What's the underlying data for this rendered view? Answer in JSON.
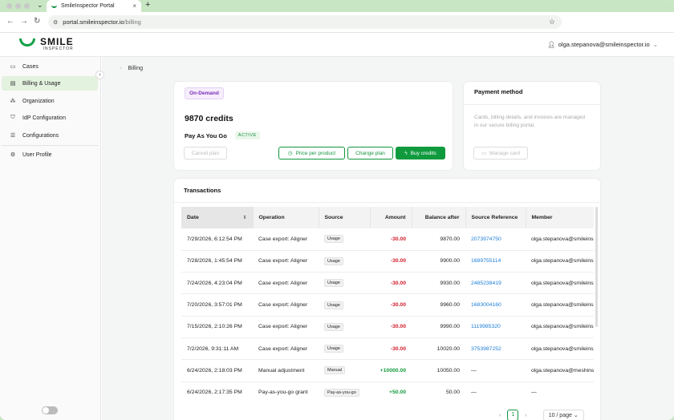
{
  "browser": {
    "tab_title": "SmileInspector Portal",
    "url_host": "portal.smileinspector.io",
    "url_path": "/billing"
  },
  "app": {
    "brand": "SMILE",
    "brand_sub": "INSPECTOR",
    "user_email": "olga.stepanova@smileinspector.io",
    "accent": "#0f9a3e"
  },
  "sidebar": {
    "items": [
      {
        "label": "Cases",
        "icon": "folder-icon"
      },
      {
        "label": "Billing & Usage",
        "icon": "billing-icon"
      },
      {
        "label": "Organization",
        "icon": "organization-icon"
      },
      {
        "label": "IdP Configuration",
        "icon": "shield-icon"
      },
      {
        "label": "Configurations",
        "icon": "sliders-icon"
      },
      {
        "label": "User Profile",
        "icon": "gear-icon"
      }
    ]
  },
  "breadcrumb": {
    "current": "Billing"
  },
  "plan": {
    "badge": "On-Demand",
    "credits": "9870 credits",
    "name": "Pay As You Go",
    "status": "ACTIVE",
    "cancel_label": "Cancel plan",
    "price_label": "Price per product",
    "change_label": "Change plan",
    "buy_label": "Buy credits"
  },
  "payment": {
    "title": "Payment method",
    "description": "Cards, billing details, and invoices are managed in our secure billing portal.",
    "manage_label": "Manage card"
  },
  "transactions": {
    "title": "Transactions",
    "columns": [
      "Date",
      "Operation",
      "Source",
      "Amount",
      "Balance after",
      "Source Reference",
      "Member"
    ],
    "rows": [
      {
        "date": "7/29/2026, 6:12:54 PM",
        "operation": "Case export: Aligner",
        "source": "Usage",
        "amount": "-30.00",
        "balance": "9870.00",
        "ref": "2073974750",
        "member": "olga.stepanova@smileinsp"
      },
      {
        "date": "7/28/2026, 1:45:54 PM",
        "operation": "Case export: Aligner",
        "source": "Usage",
        "amount": "-30.00",
        "balance": "9900.00",
        "ref": "1689755114",
        "member": "olga.stepanova@smileinsp"
      },
      {
        "date": "7/24/2026, 4:23:04 PM",
        "operation": "Case export: Aligner",
        "source": "Usage",
        "amount": "-30.00",
        "balance": "9930.00",
        "ref": "2485238419",
        "member": "olga.stepanova@smileinsp"
      },
      {
        "date": "7/20/2026, 3:57:01 PM",
        "operation": "Case export: Aligner",
        "source": "Usage",
        "amount": "-30.00",
        "balance": "9960.00",
        "ref": "1683004160",
        "member": "olga.stepanova@smileinsp"
      },
      {
        "date": "7/15/2026, 2:10:26 PM",
        "operation": "Case export: Aligner",
        "source": "Usage",
        "amount": "-30.00",
        "balance": "9990.00",
        "ref": "1119985320",
        "member": "olga.stepanova@smileinsp"
      },
      {
        "date": "7/2/2026, 9:31:11 AM",
        "operation": "Case export: Aligner",
        "source": "Usage",
        "amount": "-30.00",
        "balance": "10020.00",
        "ref": "3753987252",
        "member": "olga.stepanova@smileinsp"
      },
      {
        "date": "6/24/2026, 2:18:03 PM",
        "operation": "Manual adjustment",
        "source": "Manual",
        "amount": "+10000.00",
        "balance": "10050.00",
        "ref": "—",
        "member": "olga.stepanova@meshinsp"
      },
      {
        "date": "6/24/2026, 2:17:35 PM",
        "operation": "Pay-as-you-go grant",
        "source": "Pay-as-you-go",
        "amount": "+50.00",
        "balance": "50.00",
        "ref": "—",
        "member": "—"
      }
    ]
  },
  "pagination": {
    "current_page": "1",
    "per_page": "10 / page"
  }
}
